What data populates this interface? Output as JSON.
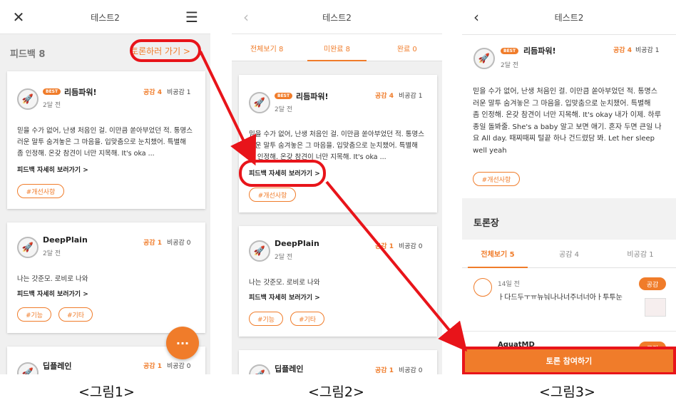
{
  "screen1": {
    "title": "테스트2",
    "feedback_title": "피드백 8",
    "go_debate": "토론하러 가기 >",
    "cards": [
      {
        "best": "BEST",
        "name": "리듬파워!",
        "time": "2달 전",
        "agree": "공감 4",
        "disagree": "비공감 1",
        "body": [
          "믿을 수가 없어, 난생 처음인 걸. 이만큼 쏟아부었던 적. 통명스",
          "러운 말투 숨겨놓은 그 마음을. 입맞춤으로 눈치챘어. 특별해",
          "좀 인정해. 온갖 참견이 너만 지목해. It's oka ..."
        ],
        "more": "피드백 자세히 보러가기 >",
        "tags": [
          "#개선사항"
        ]
      },
      {
        "name": "DeepPlain",
        "time": "2달 전",
        "agree": "공감 1",
        "disagree": "비공감 0",
        "body": [
          "나는 갓준모. 로비로 나와"
        ],
        "more": "피드백 자세히 보러가기 >",
        "tags": [
          "#기능",
          "#기타"
        ]
      },
      {
        "name": "딥플레인",
        "agree": "공감 1",
        "disagree": "비공감 0"
      }
    ],
    "fab": "···"
  },
  "screen2": {
    "title": "테스트2",
    "tabs": [
      "전체보기 8",
      "미완료 8",
      "완료 0"
    ],
    "cards": [
      {
        "best": "BEST",
        "name": "리듬파워!",
        "time": "2달 전",
        "agree": "공감 4",
        "disagree": "비공감 1",
        "body": [
          "믿을 수가 없어, 난생 처음인 걸. 이만큼 쏟아부었던 적. 통명스",
          "러운 말투 숨겨놓은 그 마음을. 입맞춤으로 눈치챘어. 특별해",
          "좀 인정해. 온갖 참견이 너만 지목해. It's oka ..."
        ],
        "more": "피드백 자세히 보러가기 >",
        "tags": [
          "#개선사항"
        ]
      },
      {
        "name": "DeepPlain",
        "time": "2달 전",
        "agree": "공감 1",
        "disagree": "비공감 0",
        "body": [
          "나는 갓준모. 로비로 나와"
        ],
        "more": "피드백 자세히 보러가기 >",
        "tags": [
          "#기능",
          "#기타"
        ]
      },
      {
        "name": "딥플레인",
        "agree": "공감 1",
        "disagree": "비공감 0"
      }
    ]
  },
  "screen3": {
    "title": "테스트2",
    "post": {
      "best": "BEST",
      "name": "리듬파워!",
      "time": "2달 전",
      "agree": "공감 4",
      "disagree": "비공감 1",
      "body": [
        "믿을 수가 없어, 난생 처음인 걸. 이만큼 쏟아부었던 적. 통명스",
        "러운 말투 숨겨놓은 그 마음을. 입맞춤으로 눈치챘어. 특별해",
        "좀 인정해. 온갖 참견이 너만 지목해. It's okay 내가 이제. 하루",
        "종일 돌봐줄. She's a baby 알고 보면 애기. 혼자 두면 큰일 나",
        "요 All day. 때찌때찌 털끝 하나 건드렸담 봐. Let her sleep",
        "well yeah"
      ],
      "tag": "#개선사항"
    },
    "debate_title": "토론장",
    "tabs": [
      "전체보기 5",
      "공감 4",
      "비공감 1"
    ],
    "comments": [
      {
        "time": "14일 전",
        "text": "ㅏ다드두ㅜㅠ뉴눠나나너주너너아ㅏ투투눈",
        "badge": "공감"
      },
      {
        "name": "AquatMD",
        "badge": "공감"
      }
    ],
    "join_button": "토론 참여하기"
  },
  "captions": [
    "<그림1>",
    "<그림2>",
    "<그림3>"
  ]
}
